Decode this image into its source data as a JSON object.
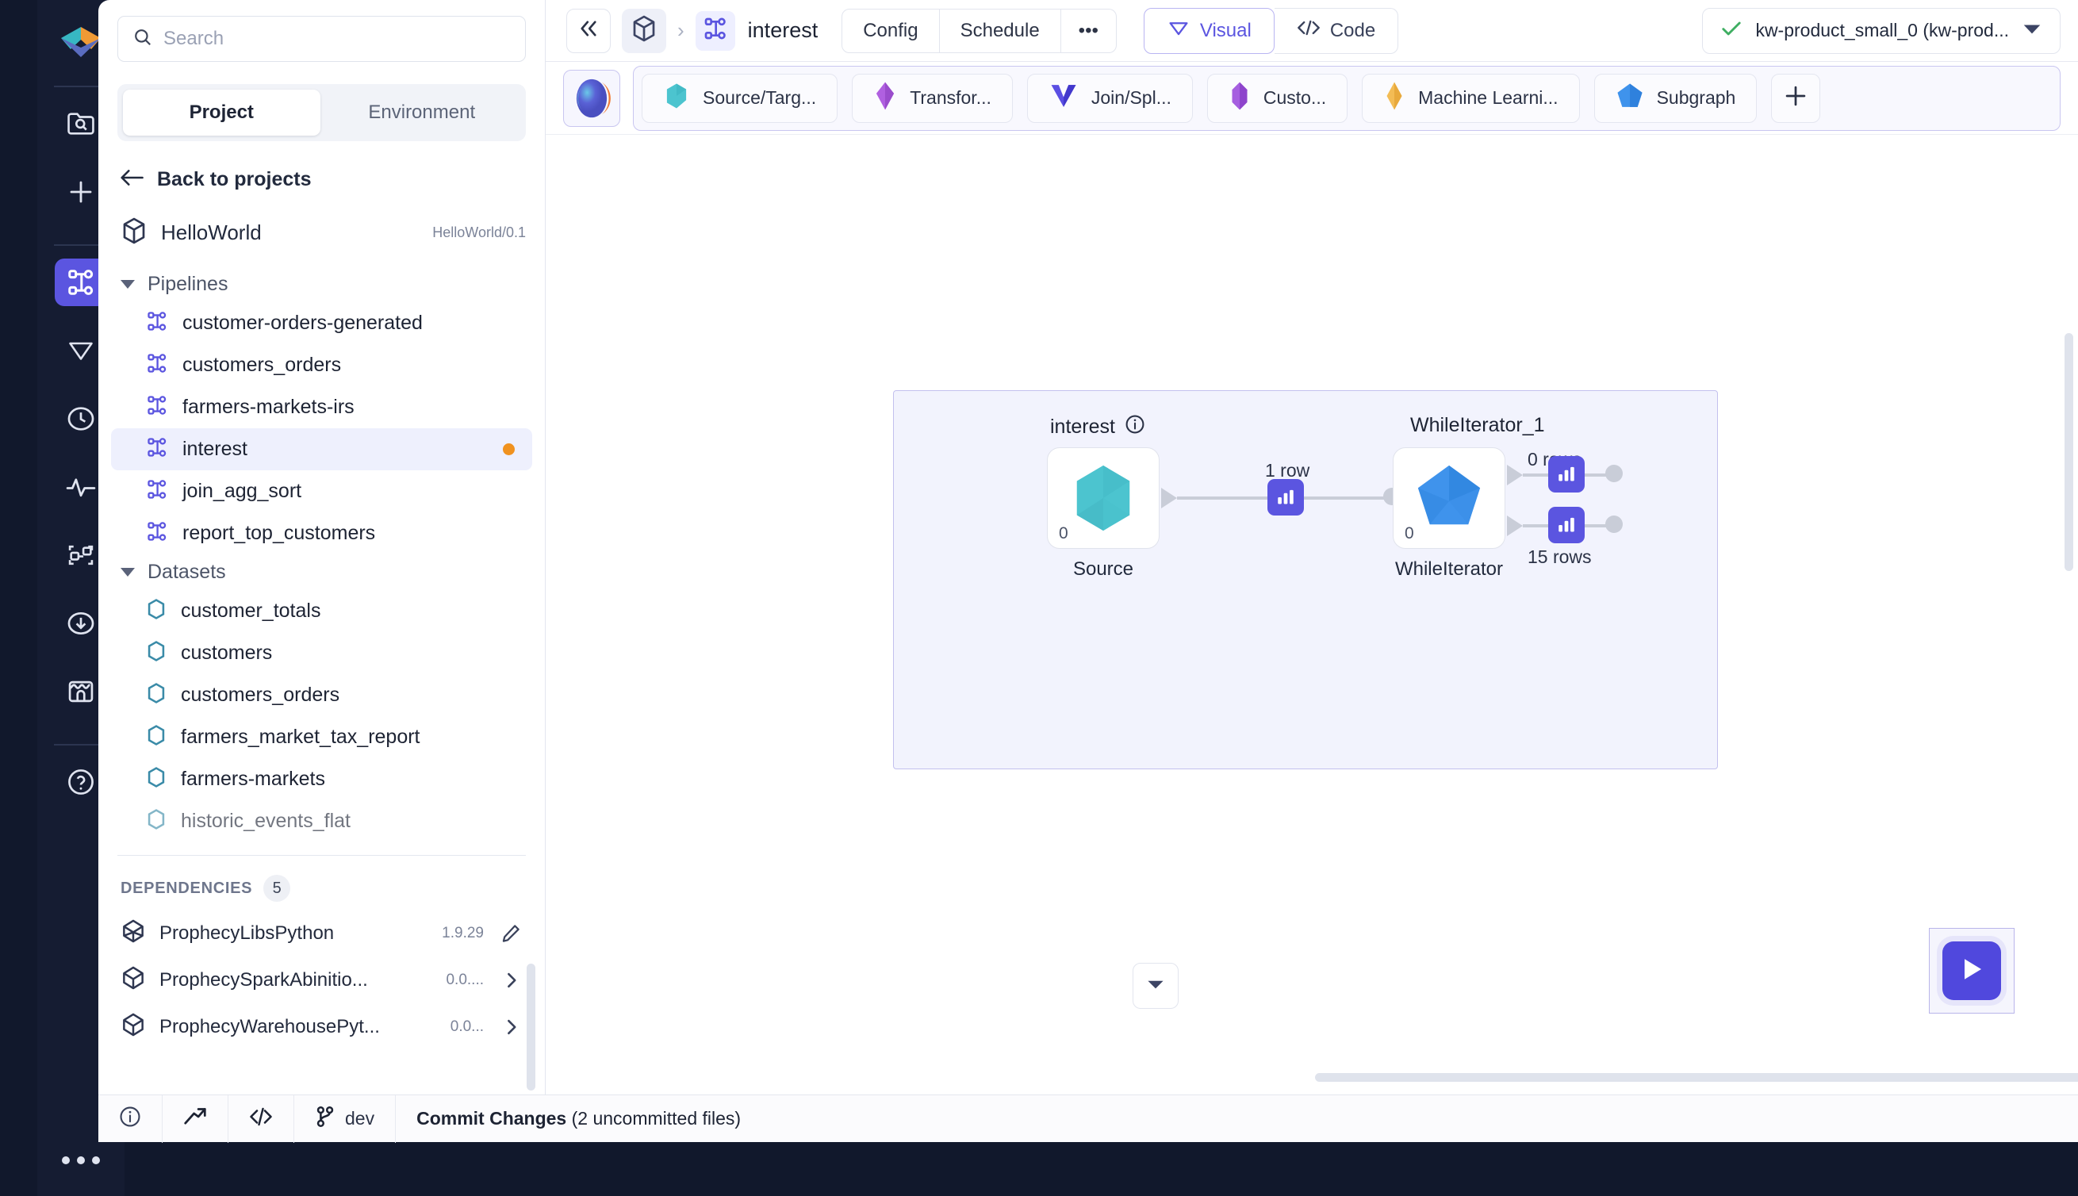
{
  "rail": {
    "logo_icon": "prophecy-logo-icon",
    "items": [
      {
        "icon": "folder-search-icon",
        "name": "browse"
      },
      {
        "icon": "plus-icon",
        "name": "create"
      },
      {
        "icon": "pipeline-graph-icon",
        "name": "pipelines",
        "active": true
      },
      {
        "icon": "diamond-icon",
        "name": "gems"
      },
      {
        "icon": "clock-icon",
        "name": "history"
      },
      {
        "icon": "activity-pulse-icon",
        "name": "monitoring"
      },
      {
        "icon": "lineage-icon",
        "name": "lineage"
      },
      {
        "icon": "download-circle-icon",
        "name": "deploy"
      },
      {
        "icon": "storefront-icon",
        "name": "marketplace"
      },
      {
        "icon": "question-circle-icon",
        "name": "help"
      }
    ],
    "overflow_icon": "more-dots-icon"
  },
  "sidebar": {
    "search": {
      "value": "",
      "placeholder": "Search",
      "icon": "search-icon"
    },
    "tabs": [
      {
        "label": "Project",
        "active": true
      },
      {
        "label": "Environment",
        "active": false
      }
    ],
    "back_label": "Back to projects",
    "back_icon": "arrow-left-icon",
    "project": {
      "name": "HelloWorld",
      "version": "HelloWorld/0.1",
      "icon": "cube-icon"
    },
    "groups": [
      {
        "title": "Pipelines",
        "items": [
          {
            "label": "customer-orders-generated",
            "selected": false,
            "badge": false
          },
          {
            "label": "customers_orders",
            "selected": false,
            "badge": false
          },
          {
            "label": "farmers-markets-irs",
            "selected": false,
            "badge": false
          },
          {
            "label": "interest",
            "selected": true,
            "badge": true
          },
          {
            "label": "join_agg_sort",
            "selected": false,
            "badge": false
          },
          {
            "label": "report_top_customers",
            "selected": false,
            "badge": false
          }
        ]
      },
      {
        "title": "Datasets",
        "items": [
          {
            "label": "customer_totals",
            "selected": false,
            "badge": false
          },
          {
            "label": "customers",
            "selected": false,
            "badge": false
          },
          {
            "label": "customers_orders",
            "selected": false,
            "badge": false
          },
          {
            "label": "farmers_market_tax_report",
            "selected": false,
            "badge": false
          },
          {
            "label": "farmers-markets",
            "selected": false,
            "badge": false
          },
          {
            "label": "historic_events_flat",
            "selected": false,
            "badge": false
          }
        ]
      }
    ],
    "dependencies": {
      "title": "DEPENDENCIES",
      "count": "5",
      "items": [
        {
          "name": "ProphecyLibsPython",
          "version": "1.9.29",
          "action": "edit-icon"
        },
        {
          "name": "ProphecySparkAbinitio...",
          "version": "0.0....",
          "action": "chevron-right-icon"
        },
        {
          "name": "ProphecyWarehousePyt...",
          "version": "0.0...",
          "action": "chevron-right-icon"
        }
      ]
    }
  },
  "topbar": {
    "collapse_icon": "chevrons-left-icon",
    "project_icon": "cube-icon",
    "separator": "›",
    "pipeline_icon": "pipeline-graph-icon",
    "pipeline_name": "interest",
    "buttons": [
      {
        "label": "Config"
      },
      {
        "label": "Schedule"
      },
      {
        "label": "•••"
      }
    ],
    "view_modes": [
      {
        "label": "Visual",
        "icon": "diamond-icon",
        "active": true
      },
      {
        "label": "Code",
        "icon": "code-brackets-icon",
        "active": false
      }
    ],
    "cluster": {
      "status_icon": "check-icon",
      "label": "kw-product_small_0 (kw-prod...",
      "dropdown_icon": "caret-down-icon"
    }
  },
  "palette": {
    "orb_icon": "prophecy-orb-icon",
    "chips": [
      {
        "label": "Source/Targ...",
        "icon": "hexagon-icon",
        "color": "#4cc4cf"
      },
      {
        "label": "Transfor...",
        "icon": "gem-purple-icon",
        "color": "#a855d6"
      },
      {
        "label": "Join/Spl...",
        "icon": "chevron-down-solid-icon",
        "color": "#5b4fe3"
      },
      {
        "label": "Custo...",
        "icon": "crystal-icon",
        "color": "#9b51e0"
      },
      {
        "label": "Machine Learni...",
        "icon": "diamond-gold-icon",
        "color": "#f0b444"
      },
      {
        "label": "Subgraph",
        "icon": "pentagon-blue-icon",
        "color": "#3a8fe8"
      }
    ],
    "add_label": "+"
  },
  "canvas": {
    "nodes": [
      {
        "title": "interest",
        "info_icon": "info-circle-icon",
        "shape": "hexagon",
        "color": "#4cc4cf",
        "count": "0",
        "footer": "Source"
      },
      {
        "title": "WhileIterator_1",
        "shape": "pentagon",
        "color": "#3a8fe8",
        "count": "0",
        "footer": "WhileIterator"
      }
    ],
    "edge_labels": [
      {
        "text": "1 row"
      },
      {
        "text": "0 rows"
      },
      {
        "text": "15 rows"
      }
    ],
    "data_badge_icon": "bar-chart-icon",
    "fit_icon": "caret-down-icon",
    "run_icon": "play-icon"
  },
  "statusbar": {
    "items": [
      {
        "icon": "info-circle-icon",
        "label": ""
      },
      {
        "icon": "trend-up-icon",
        "label": ""
      },
      {
        "icon": "code-brackets-icon",
        "label": ""
      },
      {
        "icon": "git-branch-icon",
        "label": "dev"
      }
    ],
    "commit_label": "Commit Changes",
    "commit_detail": " (2 uncommitted files)"
  },
  "colors": {
    "accent": "#5b55e0",
    "rail_bg": "#151c32",
    "badge_orange": "#f0921f",
    "subgraph_bg": "#f2f3fd",
    "subgraph_border": "#c3c0ee"
  }
}
